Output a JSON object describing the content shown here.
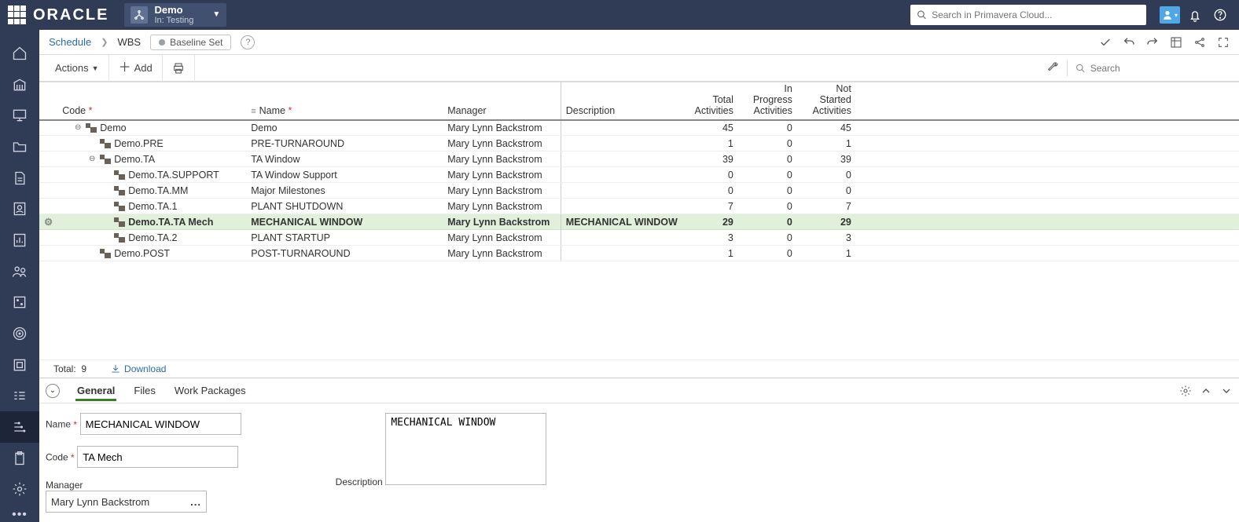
{
  "brand": "ORACLE",
  "projectContext": {
    "name": "Demo",
    "sub": "In: Testing"
  },
  "globalSearch": {
    "placeholder": "Search in Primavera Cloud..."
  },
  "breadcrumb": {
    "root": "Schedule",
    "current": "WBS",
    "chip": "Baseline Set"
  },
  "toolbar": {
    "actions": "Actions",
    "add": "Add",
    "searchPlaceholder": "Search"
  },
  "columns": {
    "code": "Code",
    "name": "Name",
    "manager": "Manager",
    "description": "Description",
    "total": "Total\nActivities",
    "inprog": "In Progress\nActivities",
    "notstarted": "Not\nStarted\nActivities"
  },
  "rows": [
    {
      "indent": 0,
      "expander": "minus",
      "code": "Demo",
      "name": "Demo",
      "manager": "Mary Lynn Backstrom",
      "description": "",
      "total": 45,
      "inprog": 0,
      "notstarted": 45,
      "selected": false
    },
    {
      "indent": 1,
      "expander": "none",
      "code": "Demo.PRE",
      "name": "PRE-TURNAROUND",
      "manager": "Mary Lynn Backstrom",
      "description": "",
      "total": 1,
      "inprog": 0,
      "notstarted": 1,
      "selected": false
    },
    {
      "indent": 1,
      "expander": "minus",
      "code": "Demo.TA",
      "name": "TA Window",
      "manager": "Mary Lynn Backstrom",
      "description": "",
      "total": 39,
      "inprog": 0,
      "notstarted": 39,
      "selected": false
    },
    {
      "indent": 2,
      "expander": "none",
      "code": "Demo.TA.SUPPORT",
      "name": "TA Window Support",
      "manager": "Mary Lynn Backstrom",
      "description": "",
      "total": 0,
      "inprog": 0,
      "notstarted": 0,
      "selected": false
    },
    {
      "indent": 2,
      "expander": "none",
      "code": "Demo.TA.MM",
      "name": "Major Milestones",
      "manager": "Mary Lynn Backstrom",
      "description": "",
      "total": 0,
      "inprog": 0,
      "notstarted": 0,
      "selected": false
    },
    {
      "indent": 2,
      "expander": "none",
      "code": "Demo.TA.1",
      "name": "PLANT SHUTDOWN",
      "manager": "Mary Lynn Backstrom",
      "description": "",
      "total": 7,
      "inprog": 0,
      "notstarted": 7,
      "selected": false
    },
    {
      "indent": 2,
      "expander": "none",
      "code": "Demo.TA.TA Mech",
      "name": "MECHANICAL WINDOW",
      "manager": "Mary Lynn Backstrom",
      "description": "MECHANICAL WINDOW",
      "total": 29,
      "inprog": 0,
      "notstarted": 29,
      "selected": true
    },
    {
      "indent": 2,
      "expander": "none",
      "code": "Demo.TA.2",
      "name": "PLANT STARTUP",
      "manager": "Mary Lynn Backstrom",
      "description": "",
      "total": 3,
      "inprog": 0,
      "notstarted": 3,
      "selected": false
    },
    {
      "indent": 1,
      "expander": "none",
      "code": "Demo.POST",
      "name": "POST-TURNAROUND",
      "manager": "Mary Lynn Backstrom",
      "description": "",
      "total": 1,
      "inprog": 0,
      "notstarted": 1,
      "selected": false
    }
  ],
  "footer": {
    "totalLabel": "Total:",
    "totalValue": "9",
    "download": "Download"
  },
  "detailTabs": {
    "general": "General",
    "files": "Files",
    "wp": "Work Packages"
  },
  "detailForm": {
    "nameLabel": "Name",
    "nameValue": "MECHANICAL WINDOW",
    "codeLabel": "Code",
    "codeValue": "TA Mech",
    "managerLabel": "Manager",
    "managerValue": "Mary Lynn Backstrom",
    "descLabel": "Description",
    "descValue": "MECHANICAL WINDOW"
  }
}
